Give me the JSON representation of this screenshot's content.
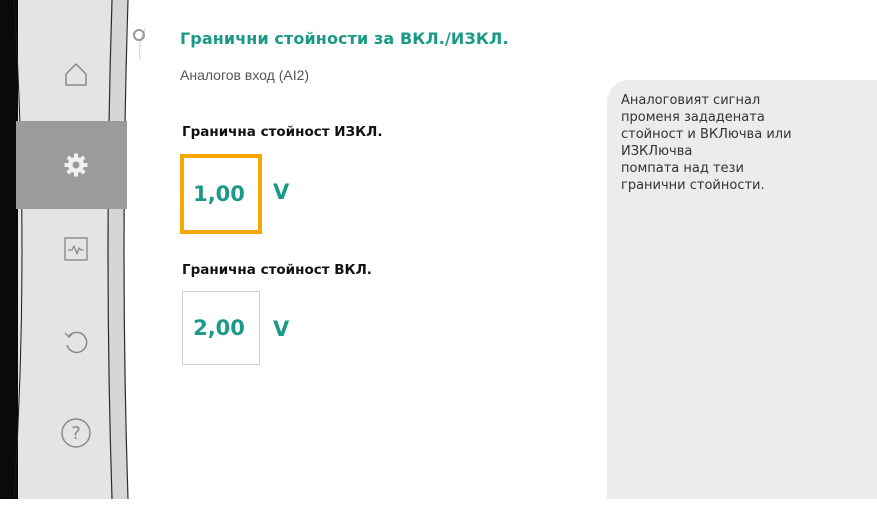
{
  "header": {
    "title": "Гранични стойности за ВКЛ./ИЗКЛ.",
    "subtitle": "Аналогов вход (AI2)"
  },
  "sidebar": {
    "items": [
      {
        "name": "home",
        "icon": "home-icon"
      },
      {
        "name": "settings",
        "icon": "gear-icon",
        "active": true
      },
      {
        "name": "diagnostics",
        "icon": "pulse-icon"
      },
      {
        "name": "back",
        "icon": "undo-icon"
      },
      {
        "name": "help",
        "icon": "help-icon",
        "label": "?"
      }
    ]
  },
  "fields": {
    "off_threshold": {
      "label": "Гранична стойност ИЗКЛ.",
      "value": "1,00",
      "unit": "V"
    },
    "on_threshold": {
      "label": "Гранична стойност ВКЛ.",
      "value": "2,00",
      "unit": "V"
    }
  },
  "help": {
    "text": "Аналоговият сигнал\nпроменя зададената\nстойност и ВКЛючва или\nИЗКЛючва\nпомпата над тези\nгранични стойности."
  },
  "colors": {
    "accent": "#1a9a86",
    "focus": "#f6a800",
    "sidebar_bg": "#e2e2e2",
    "sidebar_active": "#9a9a9a",
    "help_bg": "#ececec"
  }
}
